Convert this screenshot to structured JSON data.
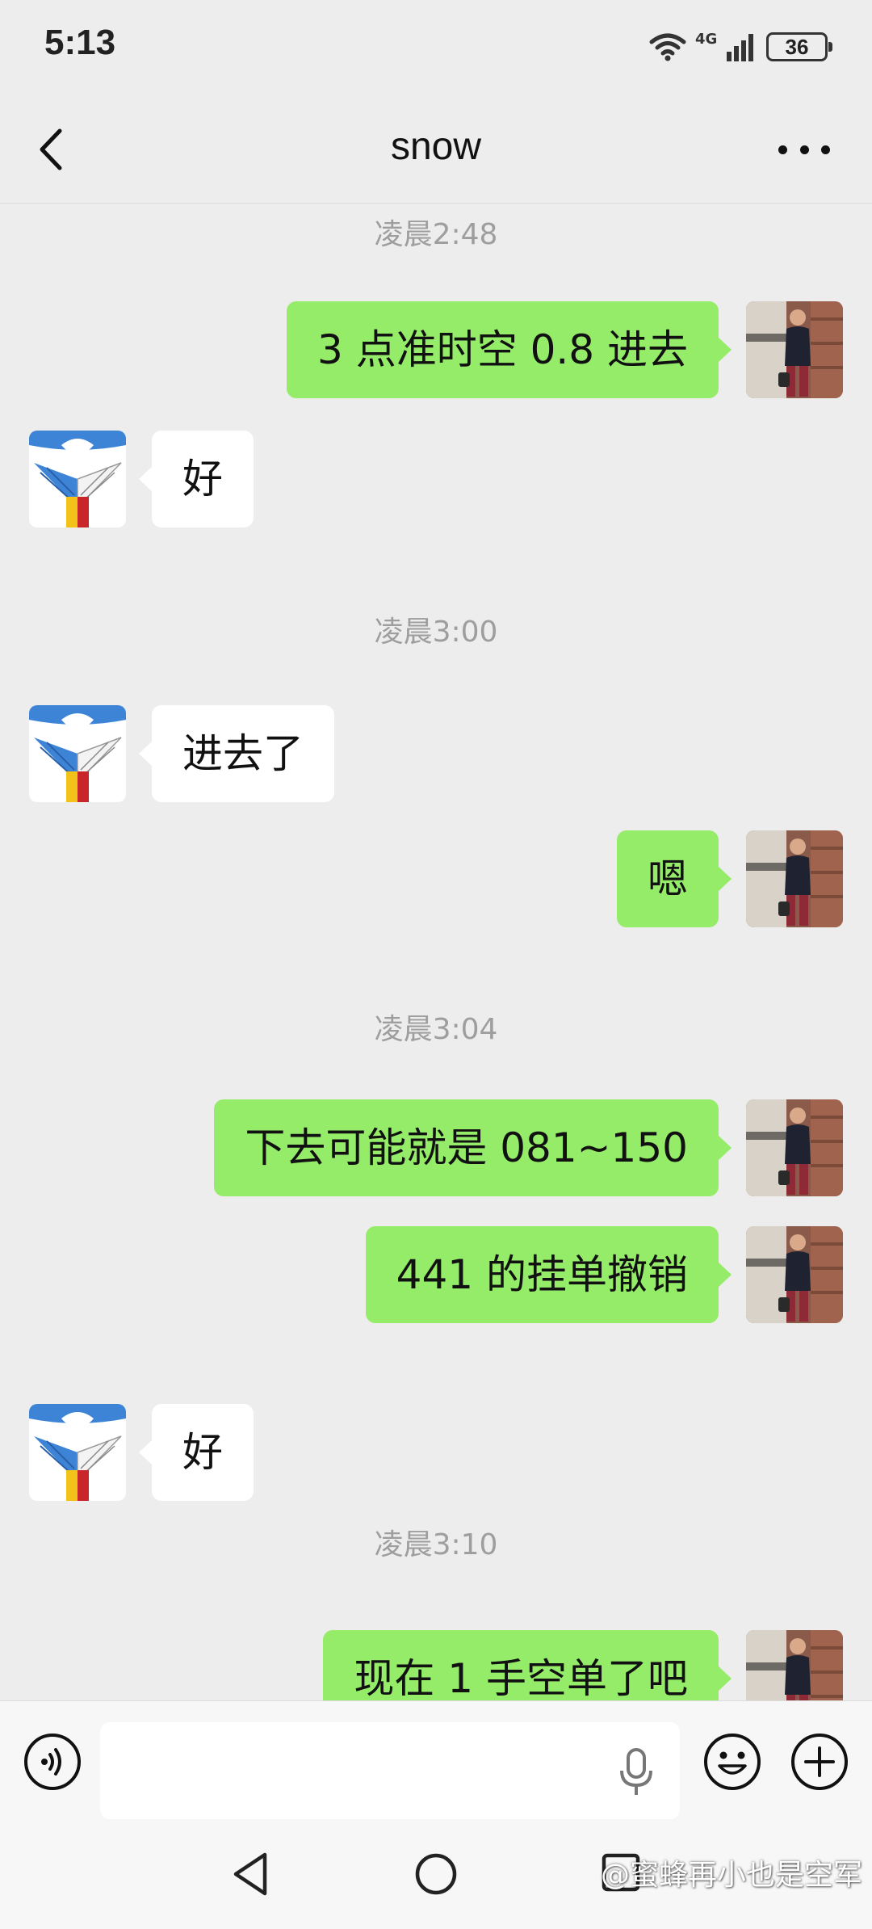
{
  "status_bar": {
    "time": "5:13",
    "network": "4G",
    "battery": "36"
  },
  "header": {
    "title": "snow"
  },
  "messages": [
    {
      "kind": "timestamp",
      "text": "凌晨2:48"
    },
    {
      "kind": "message",
      "side": "self",
      "text": "3 点准时空 0.8 进去"
    },
    {
      "kind": "message",
      "side": "other",
      "text": "好"
    },
    {
      "kind": "timestamp",
      "text": "凌晨3:00"
    },
    {
      "kind": "message",
      "side": "other",
      "text": "进去了"
    },
    {
      "kind": "message",
      "side": "self",
      "text": "嗯"
    },
    {
      "kind": "timestamp",
      "text": "凌晨3:04"
    },
    {
      "kind": "message",
      "side": "self",
      "text": "下去可能就是 081~150"
    },
    {
      "kind": "message",
      "side": "self",
      "text": "441 的挂单撤销"
    },
    {
      "kind": "message",
      "side": "other",
      "text": "好"
    },
    {
      "kind": "timestamp",
      "text": "凌晨3:10"
    },
    {
      "kind": "message",
      "side": "self",
      "text": "现在 1 手空单了吧"
    }
  ],
  "input_bar": {
    "value": ""
  },
  "icons": {
    "back": "chevron-left-icon",
    "more": "more-dots-icon",
    "voice": "voice-icon",
    "mic": "mic-icon",
    "emoji": "emoji-icon",
    "add": "plus-icon"
  },
  "watermark": "@蜜蜂再小也是空军",
  "colors": {
    "self_bubble": "#95ec69",
    "other_bubble": "#ffffff",
    "background": "#ededed"
  }
}
